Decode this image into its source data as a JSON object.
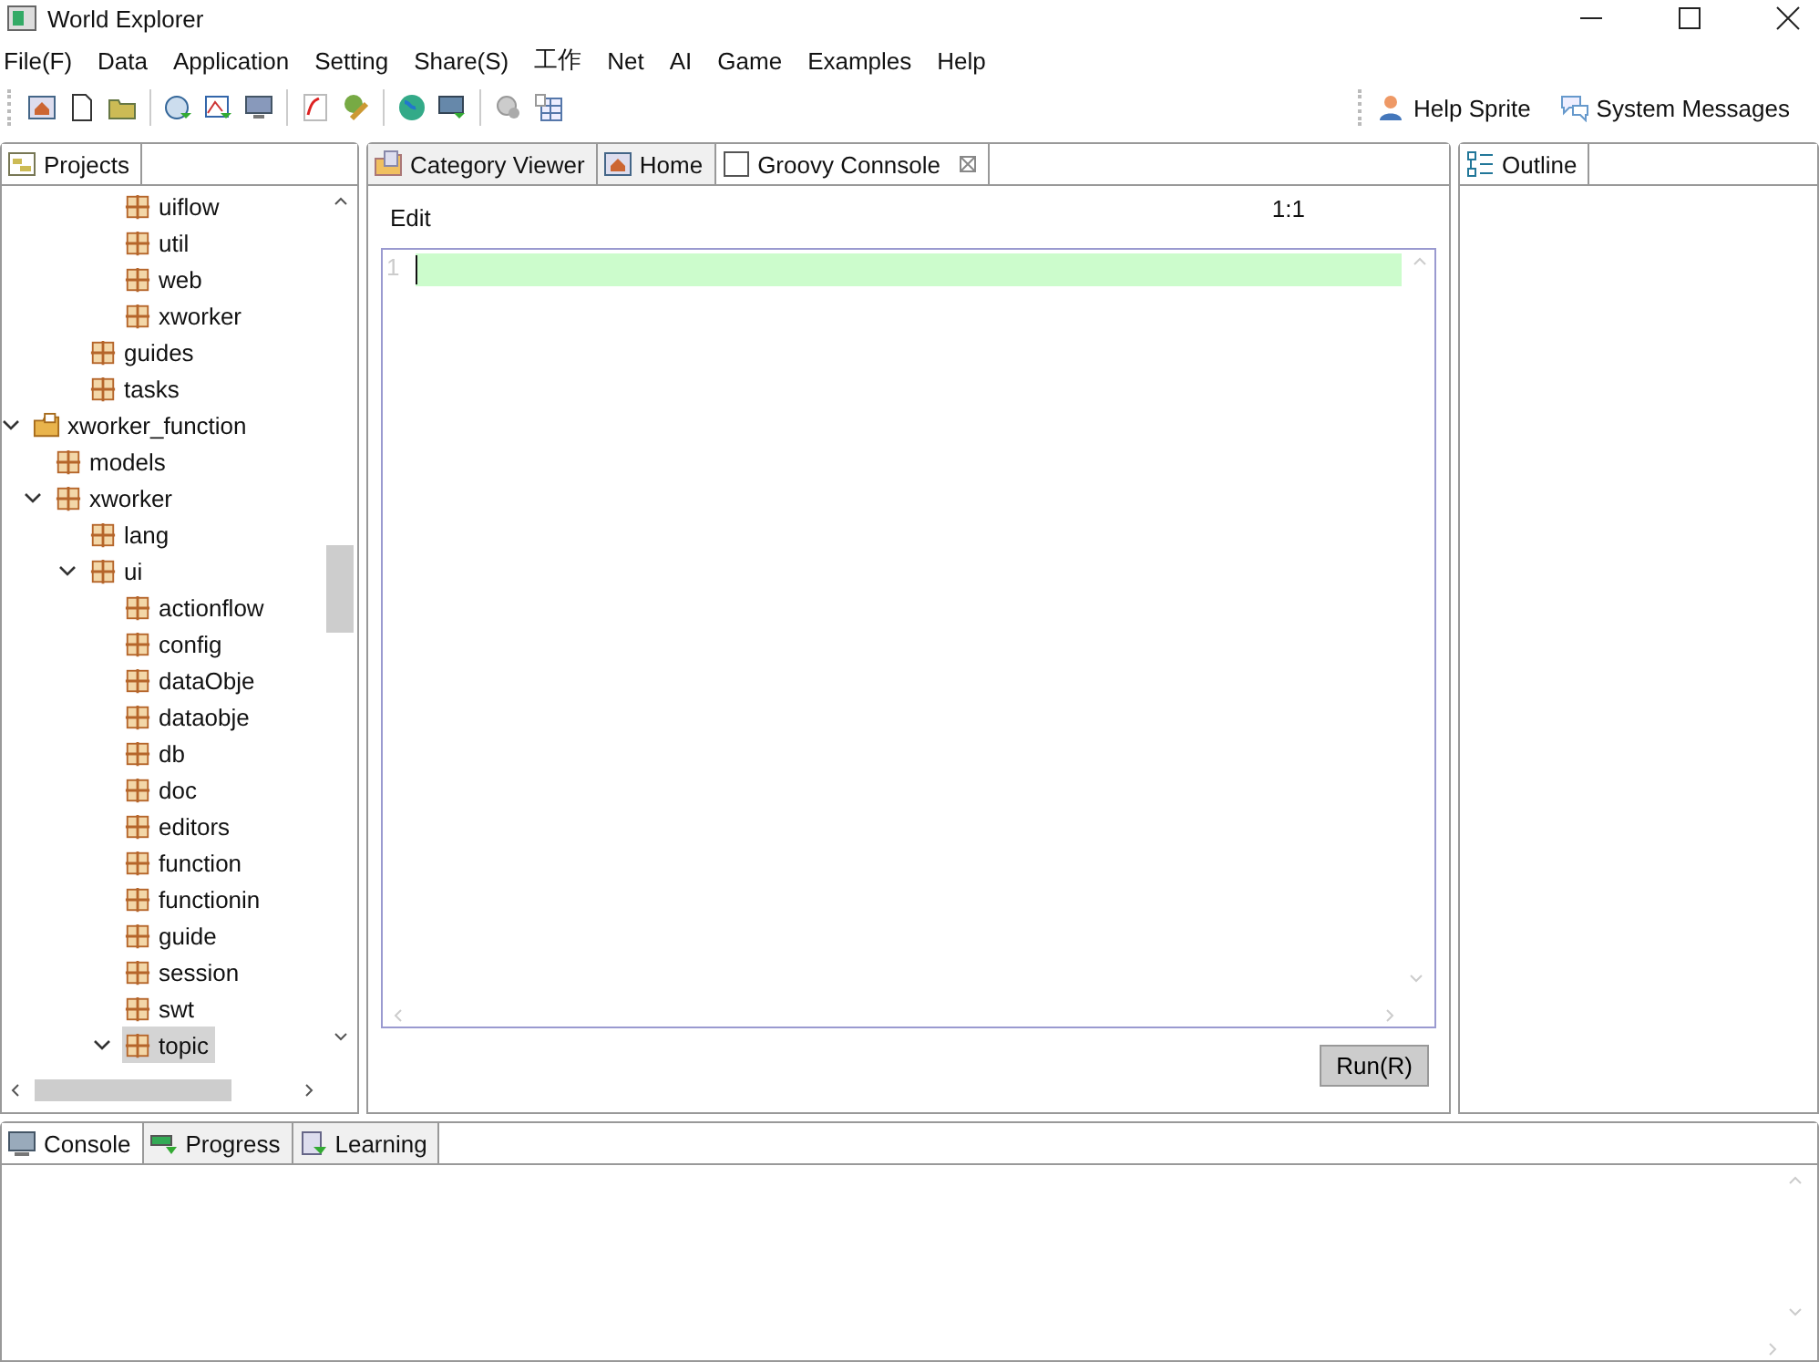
{
  "window": {
    "title": "World Explorer"
  },
  "menu": [
    "File(F)",
    "Data",
    "Application",
    "Setting",
    "Share(S)",
    "工作",
    "Net",
    "AI",
    "Game",
    "Examples",
    "Help"
  ],
  "toolbar_links": [
    {
      "label": "Help Sprite",
      "kind": "person"
    },
    {
      "label": "System Messages",
      "kind": "chat"
    }
  ],
  "projects": {
    "tab": "Projects",
    "tree": [
      {
        "children": [
          {
            "children": [
              {
                "children": [
                  {
                    "label": "uiflow",
                    "selected": false
                  },
                  {
                    "label": "util",
                    "selected": false
                  },
                  {
                    "label": "web",
                    "selected": false
                  },
                  {
                    "label": "xworker",
                    "selected": false
                  }
                ]
              },
              {
                "label": "guides",
                "selected": false
              },
              {
                "label": "tasks",
                "selected": false
              }
            ]
          }
        ]
      },
      {
        "label": "xworker_function",
        "kind": "project",
        "selected": false,
        "expanded": true,
        "children": [
          {
            "label": "models",
            "selected": false
          },
          {
            "label": "xworker",
            "selected": false,
            "expanded": true,
            "children": [
              {
                "label": "lang",
                "selected": false
              },
              {
                "label": "ui",
                "selected": false,
                "expanded": true,
                "children": [
                  {
                    "label": "actionflow",
                    "selected": false
                  },
                  {
                    "label": "config",
                    "selected": false
                  },
                  {
                    "label": "dataObje",
                    "selected": false
                  },
                  {
                    "label": "dataobje",
                    "selected": false
                  },
                  {
                    "label": "db",
                    "selected": false
                  },
                  {
                    "label": "doc",
                    "selected": false
                  },
                  {
                    "label": "editors",
                    "selected": false
                  },
                  {
                    "label": "function",
                    "selected": false
                  },
                  {
                    "label": "functionin",
                    "selected": false
                  },
                  {
                    "label": "guide",
                    "selected": false
                  },
                  {
                    "label": "session",
                    "selected": false
                  },
                  {
                    "label": "swt",
                    "selected": false
                  },
                  {
                    "label": "topic",
                    "selected": true,
                    "expanded": true
                  }
                ]
              }
            ]
          }
        ]
      }
    ]
  },
  "editor": {
    "tabs": [
      {
        "label": "Category Viewer",
        "kind": "folder",
        "selected": false
      },
      {
        "label": "Home",
        "kind": "home",
        "selected": false
      },
      {
        "label": "Groovy Connsole",
        "kind": "blank",
        "selected": true,
        "closable": true
      }
    ],
    "menu": "Edit",
    "position": "1:1",
    "line_number": "1",
    "run_button": "Run(R)"
  },
  "outline": {
    "tab": "Outline"
  },
  "bottom": {
    "tabs": [
      {
        "label": "Console",
        "kind": "monitor",
        "selected": true
      },
      {
        "label": "Progress",
        "kind": "progress",
        "selected": false
      },
      {
        "label": "Learning",
        "kind": "learn",
        "selected": false
      }
    ]
  }
}
